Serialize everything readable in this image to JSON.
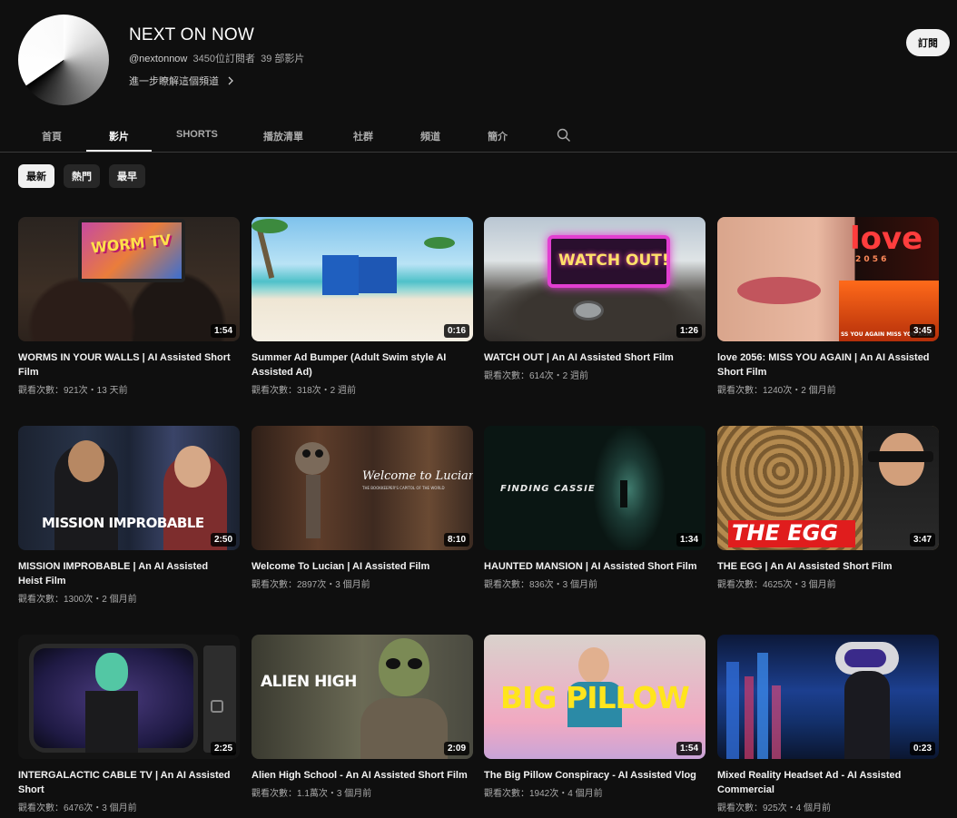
{
  "channel": {
    "name": "NEXT ON NOW",
    "handle": "@nextonnow",
    "subscribers": "3450位訂閱者",
    "video_count": "39 部影片",
    "more_about": "進一步瞭解這個頻道",
    "subscribe_label": "訂閱"
  },
  "tabs": [
    "首頁",
    "影片",
    "SHORTS",
    "播放清單",
    "社群",
    "頻道",
    "簡介"
  ],
  "active_tab": "影片",
  "chips": [
    "最新",
    "熱門",
    "最早"
  ],
  "active_chip": "最新",
  "videos": [
    {
      "title": "WORMS IN YOUR WALLS | AI Assisted Short Film",
      "meta": "觀看次數：921次・13 天前",
      "duration": "1:54",
      "thumb_text": "WORM TV"
    },
    {
      "title": "Summer Ad Bumper (Adult Swim style AI Assisted Ad)",
      "meta": "觀看次數：318次・2 週前",
      "duration": "0:16",
      "thumb_text": ""
    },
    {
      "title": "WATCH OUT | An AI Assisted Short Film",
      "meta": "觀看次數：614次・2 週前",
      "duration": "1:26",
      "thumb_text": "WATCH OUT!"
    },
    {
      "title": "love 2056: MISS YOU AGAIN | An AI Assisted Short Film",
      "meta": "觀看次數：1240次・2 個月前",
      "duration": "3:45",
      "thumb_text": "love",
      "thumb_sub": "2 0 5 6",
      "thumb_caption": "SS YOU AGAIN  MISS YOU AGAI"
    },
    {
      "title": "MISSION IMPROBABLE | An AI Assisted Heist Film",
      "meta": "觀看次數：1300次・2 個月前",
      "duration": "2:50",
      "thumb_text": "MISSION IMPROBABLE"
    },
    {
      "title": "Welcome To Lucian | AI Assisted Film",
      "meta": "觀看次數：2897次・3 個月前",
      "duration": "8:10",
      "thumb_text": "Welcome to Lucian",
      "thumb_sub": "THE BOOKKEEPER'S CAPITOL OF THE WORLD"
    },
    {
      "title": "HAUNTED MANSION | AI Assisted Short Film",
      "meta": "觀看次數：836次・3 個月前",
      "duration": "1:34",
      "thumb_text": "FINDING CASSIE"
    },
    {
      "title": "THE EGG | An AI Assisted Short Film",
      "meta": "觀看次數：4625次・3 個月前",
      "duration": "3:47",
      "thumb_text": "THE EGG"
    },
    {
      "title": "INTERGALACTIC CABLE TV | An AI Assisted Short",
      "meta": "觀看次數：6476次・3 個月前",
      "duration": "2:25",
      "thumb_text": ""
    },
    {
      "title": "Alien High School - An AI Assisted Short Film",
      "meta": "觀看次數：1.1萬次・3 個月前",
      "duration": "2:09",
      "thumb_text": "ALIEN HIGH"
    },
    {
      "title": "The Big Pillow Conspiracy - AI Assisted Vlog",
      "meta": "觀看次數：1942次・4 個月前",
      "duration": "1:54",
      "thumb_text": "BIG PILLOW"
    },
    {
      "title": "Mixed Reality Headset Ad - AI Assisted Commercial",
      "meta": "觀看次數：925次・4 個月前",
      "duration": "0:23",
      "thumb_text": ""
    }
  ]
}
